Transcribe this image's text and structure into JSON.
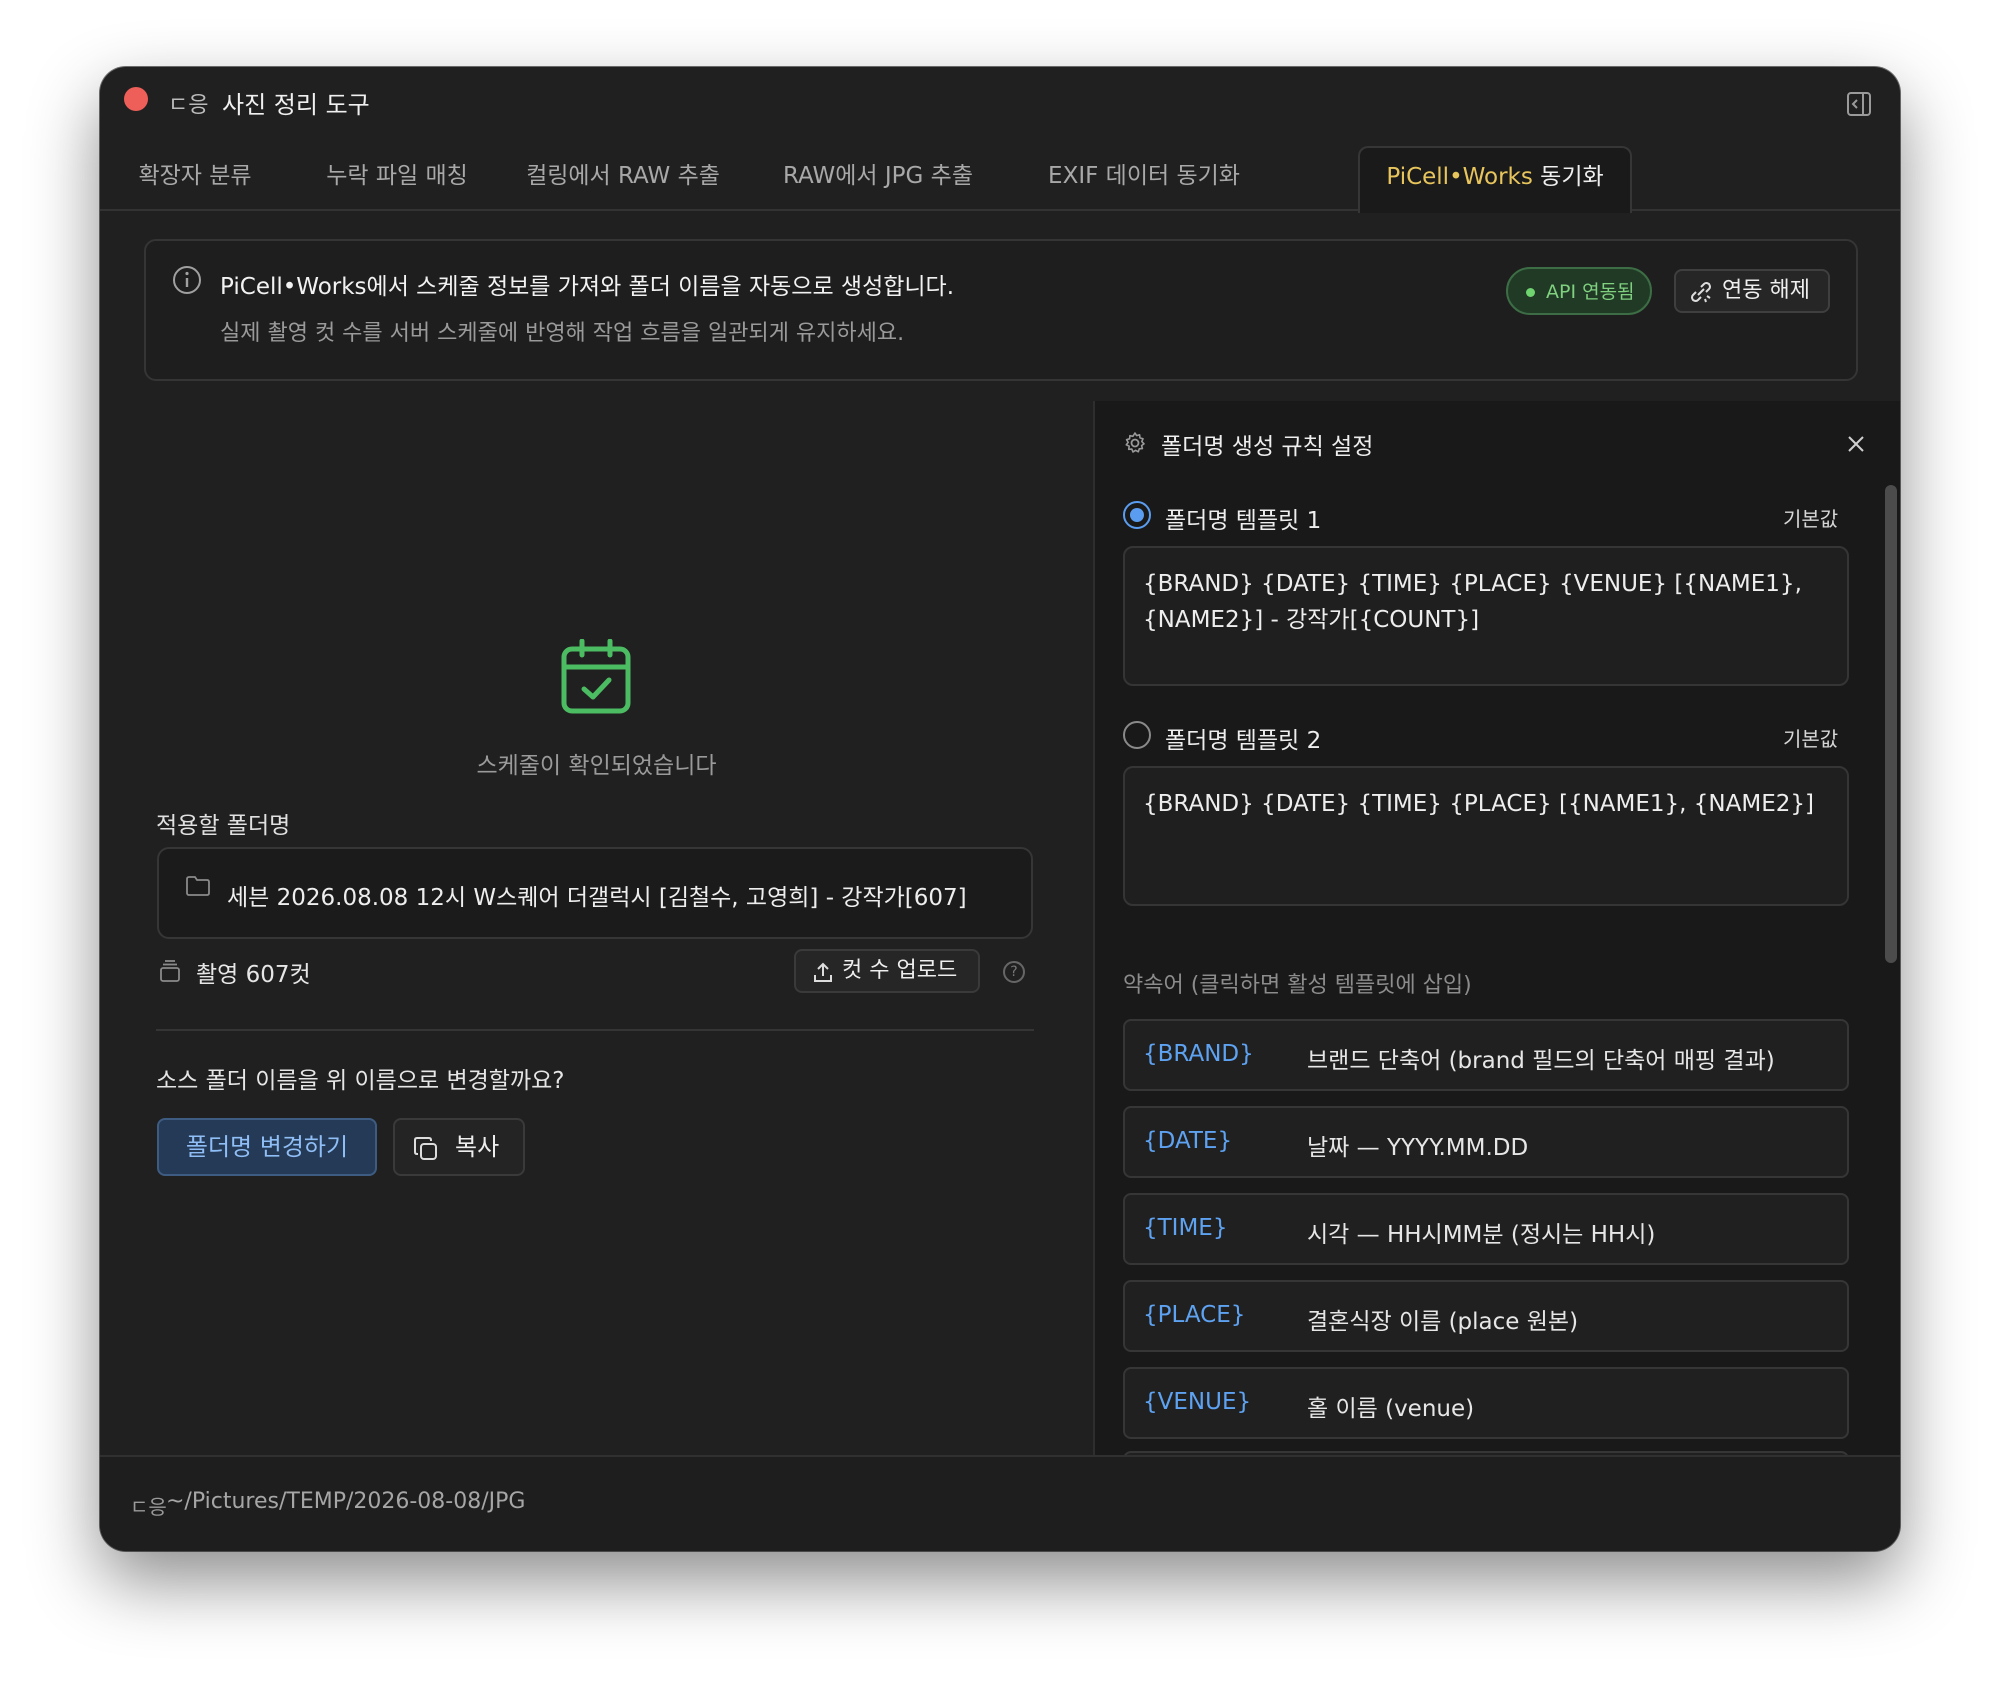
{
  "window": {
    "title": "사진 정리 도구",
    "app_glyph": "ㄷ응"
  },
  "tabs": [
    {
      "label": "확장자 분류"
    },
    {
      "label": "누락 파일 매칭"
    },
    {
      "label": "컬링에서 RAW 추출"
    },
    {
      "label": "RAW에서 JPG 추출"
    },
    {
      "label": "EXIF 데이터 동기화"
    },
    {
      "label": "PiCell•Works",
      "suffix": " 동기화",
      "active": true
    }
  ],
  "banner": {
    "line1": "PiCell•Works에서 스케줄 정보를 가져와 폴더 이름을 자동으로 생성합니다.",
    "line2": "실제 촬영 컷 수를 서버 스케줄에 반영해 작업 흐름을 일관되게 유지하세요.",
    "api_status": "API 연동됨",
    "unlink_label": "연동 해제"
  },
  "left": {
    "confirmed_text": "스케줄이 확인되었습니다",
    "folder_label": "적용할 폴더명",
    "folder_name": "세븐 2026.08.08 12시 W스퀘어 더갤럭시 [김철수, 고영희] - 강작가[607]",
    "shots_text": "촬영 607컷",
    "upload_label": "컷 수 업로드",
    "question": "소스 폴더 이름을 위 이름으로 변경할까요?",
    "rename_label": "폴더명 변경하기",
    "copy_label": "복사"
  },
  "right": {
    "title": "폴더명 생성 규칙 설정",
    "templates": [
      {
        "label": "폴더명 템플릿 1",
        "default_label": "기본값",
        "value": "{BRAND} {DATE} {TIME} {PLACE} {VENUE} [{NAME1}, {NAME2}] - 강작가[{COUNT}]",
        "selected": true
      },
      {
        "label": "폴더명 템플릿 2",
        "default_label": "기본값",
        "value": "{BRAND} {DATE} {TIME} {PLACE} [{NAME1}, {NAME2}]",
        "selected": false
      }
    ],
    "shortcuts_header": "약속어 (클릭하면 활성 템플릿에 삽입)",
    "shortcuts": [
      {
        "key": "{BRAND}",
        "desc": "브랜드 단축어 (brand 필드의 단축어 매핑 결과)"
      },
      {
        "key": "{DATE}",
        "desc": "날짜 — YYYY.MM.DD"
      },
      {
        "key": "{TIME}",
        "desc": "시각 — HH시MM분 (정시는 HH시)"
      },
      {
        "key": "{PLACE}",
        "desc": "결혼식장 이름 (place 원본)"
      },
      {
        "key": "{VENUE}",
        "desc": "홀 이름 (venue)"
      }
    ]
  },
  "status": {
    "glyph": "ㄷ응",
    "path": "~/Pictures/TEMP/2026-08-08/JPG"
  },
  "colors": {
    "accent_tab": "#e8c55c",
    "shortcut_key": "#5ea2f2",
    "api_green": "#6fd36f",
    "primary_button": "#243a56",
    "close_red": "#ed5f58"
  }
}
